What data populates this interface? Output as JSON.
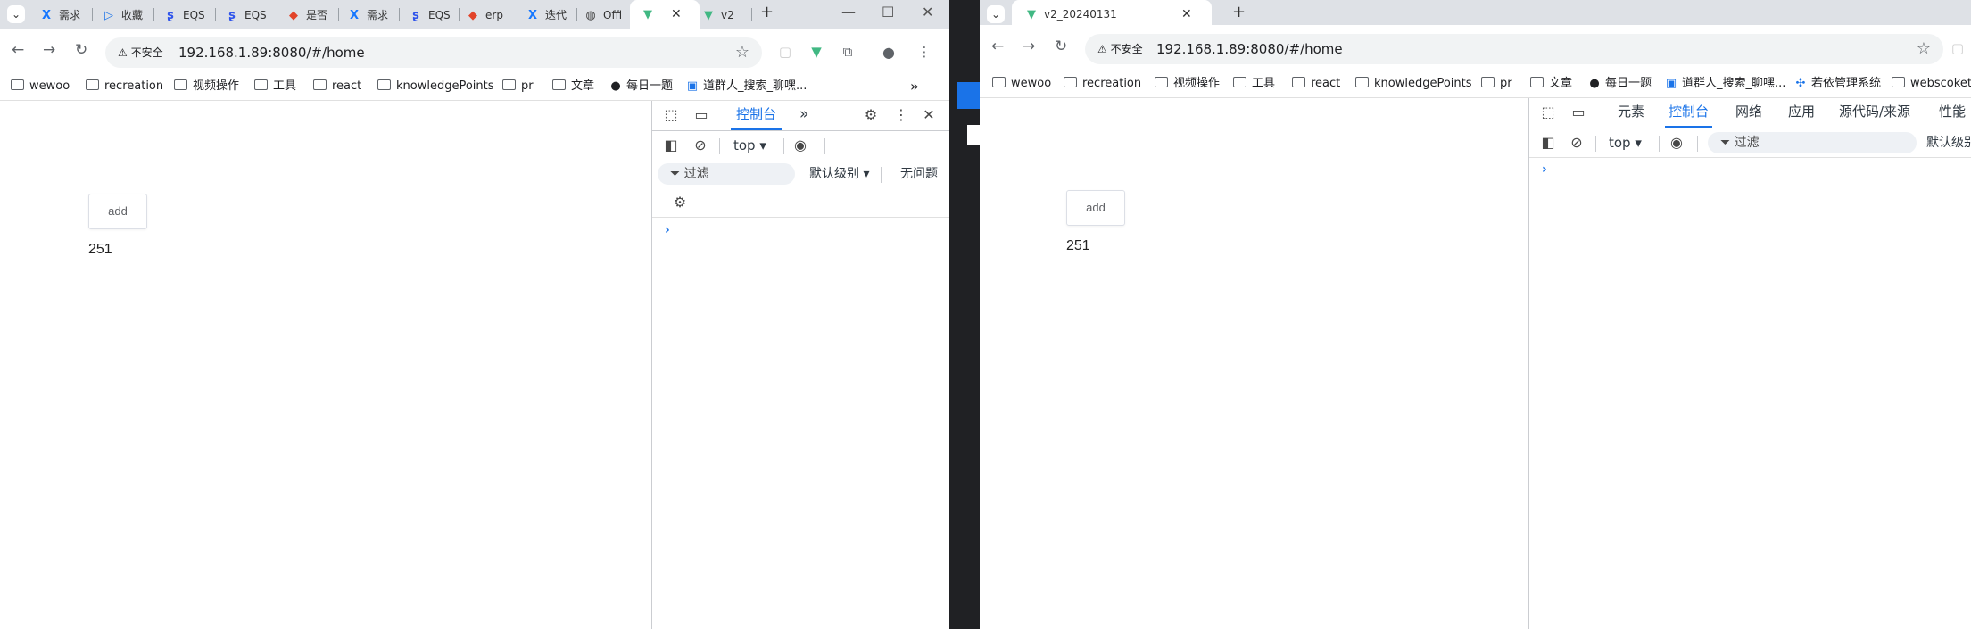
{
  "win1": {
    "tabs": [
      {
        "icon": "X",
        "label": "需求"
      },
      {
        "icon": "▷",
        "label": "收藏"
      },
      {
        "icon": "ʂ",
        "label": "EQS"
      },
      {
        "icon": "ʂ",
        "label": "EQS"
      },
      {
        "icon": "◆",
        "label": "是否"
      },
      {
        "icon": "X",
        "label": "需求"
      },
      {
        "icon": "ʂ",
        "label": "EQS"
      },
      {
        "icon": "◆",
        "label": "erp"
      },
      {
        "icon": "X",
        "label": "迭代"
      },
      {
        "icon": "◍",
        "label": "Offi"
      },
      {
        "icon": "▼",
        "label": "",
        "active": true
      },
      {
        "icon": "▼",
        "label": "v2_"
      }
    ],
    "address": {
      "security": "不安全",
      "url": "192.168.1.89:8080/#/home"
    },
    "bookmarks": [
      "wewoo",
      "recreation",
      "视频操作",
      "工具",
      "react",
      "knowledgePoints",
      "pr",
      "文章",
      "每日一题",
      "道群人_搜索_聊嘿..."
    ],
    "bookmarks_more": "»",
    "page": {
      "button": "add",
      "count": "251"
    },
    "devtools": {
      "tab_console": "控制台",
      "more_tabs": "»",
      "context": "top",
      "filter_placeholder": "过滤",
      "level": "默认级别",
      "issues": "无问题"
    }
  },
  "win2": {
    "tab_title": "v2_20240131",
    "address": {
      "security": "不安全",
      "url": "192.168.1.89:8080/#/home"
    },
    "bookmarks": [
      "wewoo",
      "recreation",
      "视频操作",
      "工具",
      "react",
      "knowledgePoints",
      "pr",
      "文章",
      "每日一题",
      "道群人_搜索_聊嘿...",
      "若依管理系统",
      "webscoket"
    ],
    "page": {
      "button": "add",
      "count": "251"
    },
    "devtools": {
      "tabs": [
        "元素",
        "控制台",
        "网络",
        "应用",
        "源代码/来源",
        "性能"
      ],
      "context": "top",
      "filter_placeholder": "过滤",
      "level": "默认级别"
    }
  },
  "colors": {
    "accent": "#1a73e8",
    "tabbar": "#dee1e6"
  }
}
